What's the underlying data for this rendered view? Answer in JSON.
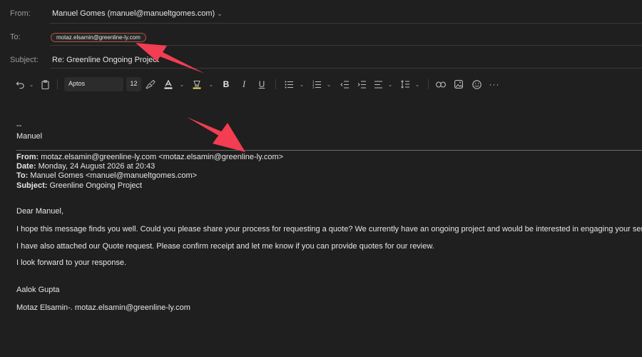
{
  "header": {
    "from_label": "From:",
    "from_value": "Manuel Gomes (manuel@manueltgomes.com)",
    "to_label": "To:",
    "to_recipient": "motaz.elsamin@greenline-ly.com",
    "subject_label": "Subject:",
    "subject_value": "Re: Greenline Ongoing Project"
  },
  "toolbar": {
    "font_name": "Aptos",
    "font_size": "12",
    "icons": [
      "undo-icon",
      "chevron-down-icon",
      "clipboard-icon",
      "format-painter-icon",
      "font-color-icon",
      "highlight-icon",
      "bold-icon",
      "italic-icon",
      "underline-icon",
      "bullets-icon",
      "numbering-icon",
      "decrease-indent-icon",
      "increase-indent-icon",
      "align-icon",
      "line-spacing-icon",
      "link-icon",
      "image-icon",
      "emoji-icon",
      "more-icon"
    ]
  },
  "signature": {
    "dashes": "--",
    "name": "Manuel"
  },
  "quoted": {
    "from_label": "From:",
    "from_value": " motaz.elsamin@greenline-ly.com <motaz.elsamin@greenline-ly.com>",
    "date_label": "Date:",
    "date_value": " Monday, 24 August 2026 at 20:43",
    "to_label": "To:",
    "to_value": " Manuel Gomes <manuel@manueltgomes.com>",
    "subject_label": "Subject:",
    "subject_value": " Greenline Ongoing Project",
    "greeting": "Dear Manuel,",
    "para1": "I hope this message finds you well. Could you please share your process for requesting a quote? We currently have an ongoing project and would be interested in engaging your services.",
    "para2": "I have also attached our Quote request. Please confirm receipt and let me know if you can provide quotes for our review.",
    "para3": "I look forward to your response.",
    "sender_name": "Aalok Gupta",
    "sender_line": "Motaz Elsamin-. motaz.elsamin@greenline-ly.com"
  },
  "colors": {
    "background": "#1f1f1f",
    "annotation_arrow": "#f23d52",
    "pill_border": "#b5503f"
  }
}
